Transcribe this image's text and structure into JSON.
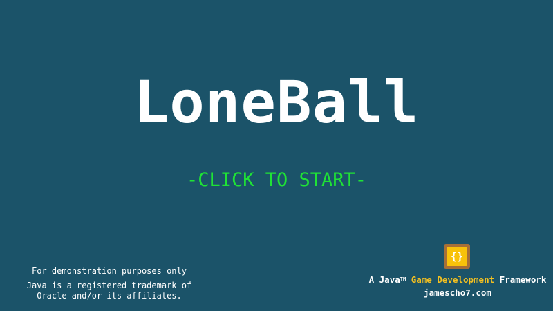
{
  "title": "LoneBall",
  "start_prompt": "-CLICK TO START-",
  "disclaimer": {
    "demo": "For demonstration purposes only",
    "trademark": "Java is a registered trademark of Oracle and/or its affiliates."
  },
  "branding": {
    "logo_icon": "curly-braces-logo",
    "logo_glyph": "{}",
    "prefix": "A Java",
    "trademark_symbol": "TM",
    "highlight": "Game Development",
    "suffix": "Framework",
    "website": "jamescho7.com"
  },
  "colors": {
    "background": "#1b5369",
    "title": "#ffffff",
    "start_prompt": "#1fe335",
    "highlight": "#f4c020",
    "logo_outer": "#a76f37",
    "logo_inner": "#f8c20a"
  }
}
